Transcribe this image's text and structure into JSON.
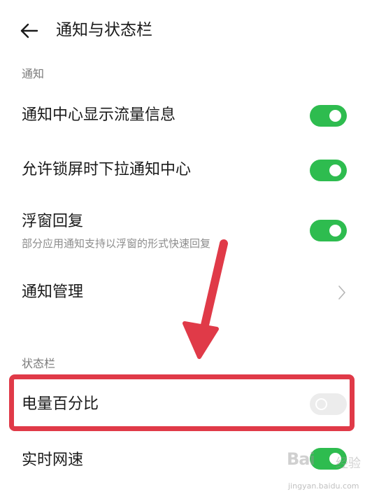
{
  "header": {
    "title": "通知与状态栏",
    "back_icon": "arrow-left-icon"
  },
  "sections": {
    "notifications_label": "通知",
    "statusbar_label": "状态栏"
  },
  "rows": {
    "traffic_info": {
      "label": "通知中心显示流量信息",
      "enabled": true
    },
    "lockscreen_pull": {
      "label": "允许锁屏时下拉通知中心",
      "enabled": true
    },
    "floating_reply": {
      "label": "浮窗回复",
      "sub": "部分应用通知支持以浮窗的形式快速回复",
      "enabled": true
    },
    "notification_mgmt": {
      "label": "通知管理",
      "icon": "chevron-right-icon"
    },
    "battery_percent": {
      "label": "电量百分比",
      "enabled": false
    },
    "realtime_speed": {
      "label": "实时网速",
      "enabled": true
    }
  },
  "annotation": {
    "box_color": "#e03a48",
    "arrow_color": "#e03a48"
  },
  "watermark": {
    "brand": "Bai",
    "text": "经验",
    "url": "jingyan.baidu.com"
  },
  "colors": {
    "toggle_on": "#2ebc4f",
    "toggle_off": "#ececec",
    "section_label": "#7a7a7a"
  }
}
